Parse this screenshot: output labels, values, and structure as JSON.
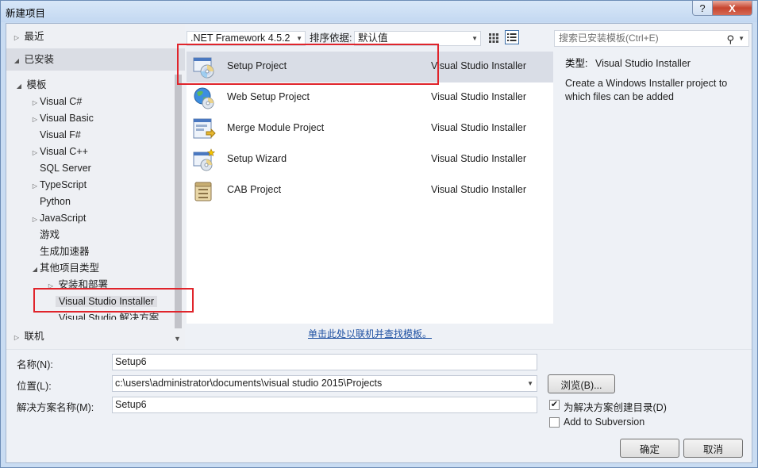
{
  "window": {
    "title": "新建项目",
    "help_label": "?",
    "close_label": "X"
  },
  "left_panel": {
    "recent_label": "最近",
    "installed_label": "已安装",
    "templates_label": "模板",
    "online_label": "联机",
    "tree_items": [
      {
        "label": "Visual C#",
        "expandable": true
      },
      {
        "label": "Visual Basic",
        "expandable": true
      },
      {
        "label": "Visual F#",
        "expandable": false
      },
      {
        "label": "Visual C++",
        "expandable": true
      },
      {
        "label": "SQL Server",
        "expandable": false
      },
      {
        "label": "TypeScript",
        "expandable": true
      },
      {
        "label": "Python",
        "expandable": false
      },
      {
        "label": "JavaScript",
        "expandable": true
      },
      {
        "label": "游戏",
        "expandable": false
      },
      {
        "label": "生成加速器",
        "expandable": false
      },
      {
        "label": "其他项目类型",
        "expandable": true,
        "expanded": true
      }
    ],
    "sub_items": [
      {
        "label": "安装和部署",
        "expandable": true
      },
      {
        "label": "Visual Studio Installer",
        "selected": true
      },
      {
        "label": "Visual Studio 解决方案"
      }
    ]
  },
  "toolbar": {
    "framework": ".NET Framework 4.5.2",
    "sort_label": "排序依据:",
    "sort_value": "默认值"
  },
  "templates": [
    {
      "name": "Setup Project",
      "type": "Visual Studio Installer",
      "icon": "setup-project-icon",
      "selected": true
    },
    {
      "name": "Web Setup Project",
      "type": "Visual Studio Installer",
      "icon": "web-setup-project-icon"
    },
    {
      "name": "Merge Module Project",
      "type": "Visual Studio Installer",
      "icon": "merge-module-icon"
    },
    {
      "name": "Setup Wizard",
      "type": "Visual Studio Installer",
      "icon": "setup-wizard-icon"
    },
    {
      "name": "CAB Project",
      "type": "Visual Studio Installer",
      "icon": "cab-project-icon"
    }
  ],
  "online_link": "单击此处以联机并查找模板。",
  "search": {
    "placeholder": "搜索已安装模板(Ctrl+E)"
  },
  "description": {
    "type_label": "类型:",
    "type_value": "Visual Studio Installer",
    "text": "Create a Windows Installer project to which files can be added"
  },
  "form": {
    "name_label": "名称(N):",
    "name_value": "Setup6",
    "location_label": "位置(L):",
    "location_value": "c:\\users\\administrator\\documents\\visual studio 2015\\Projects",
    "solution_label": "解决方案名称(M):",
    "solution_value": "Setup6",
    "browse_label": "浏览(B)...",
    "create_dir_label": "为解决方案创建目录(D)",
    "create_dir_checked": true,
    "subversion_label": "Add to Subversion",
    "subversion_checked": false,
    "ok_label": "确定",
    "cancel_label": "取消"
  },
  "colors": {
    "highlight_box": "#e0242b",
    "link": "#1e50a2",
    "selected_row": "#d9dde6"
  }
}
